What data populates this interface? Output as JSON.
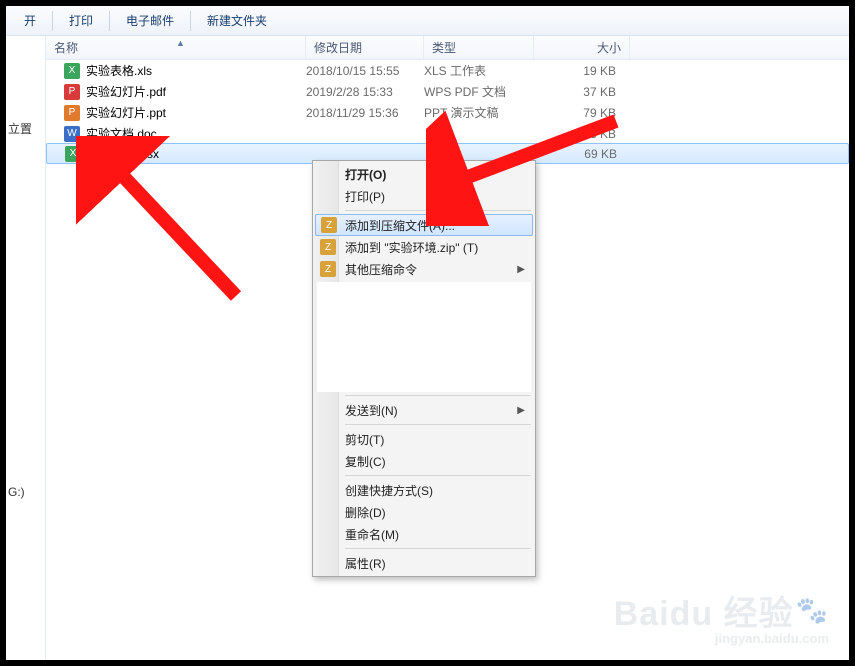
{
  "toolbar": {
    "open": "开",
    "print": "打印",
    "email": "电子邮件",
    "new_folder": "新建文件夹"
  },
  "sidebar": {
    "location_label": "立置",
    "drive_label": "G:)"
  },
  "columns": {
    "name": "名称",
    "date": "修改日期",
    "type": "类型",
    "size": "大小"
  },
  "files": [
    {
      "icon": "xls",
      "name": "实验表格.xls",
      "date": "2018/10/15 15:55",
      "type": "XLS 工作表",
      "size": "19 KB",
      "selected": false
    },
    {
      "icon": "pdf",
      "name": "实验幻灯片.pdf",
      "date": "2019/2/28 15:33",
      "type": "WPS PDF 文档",
      "size": "37 KB",
      "selected": false
    },
    {
      "icon": "ppt",
      "name": "实验幻灯片.ppt",
      "date": "2018/11/29 15:36",
      "type": "PPT 演示文稿",
      "size": "79 KB",
      "selected": false
    },
    {
      "icon": "doc",
      "name": "实验文档.doc",
      "date": "",
      "type": "",
      "size": "13 KB",
      "selected": false
    },
    {
      "icon": "xlsx",
      "name": "统计三率.xlsx",
      "date": "",
      "type": "",
      "size": "69 KB",
      "selected": true
    }
  ],
  "context_menu": {
    "open": "打开(O)",
    "print": "打印(P)",
    "add_archive": "添加到压缩文件(A)...",
    "add_zip": "添加到 \"实验环境.zip\" (T)",
    "other_zip": "其他压缩命令",
    "send_to": "发送到(N)",
    "cut": "剪切(T)",
    "copy": "复制(C)",
    "shortcut": "创建快捷方式(S)",
    "delete": "删除(D)",
    "rename": "重命名(M)",
    "properties": "属性(R)"
  },
  "watermark": {
    "brand": "Baidu 经验",
    "url": "jingyan.baidu.com"
  },
  "annotations": {
    "arrow1_target": "selected-file 统计三率.xlsx",
    "arrow2_target": "context-menu-item 添加到压缩文件(A)..."
  }
}
